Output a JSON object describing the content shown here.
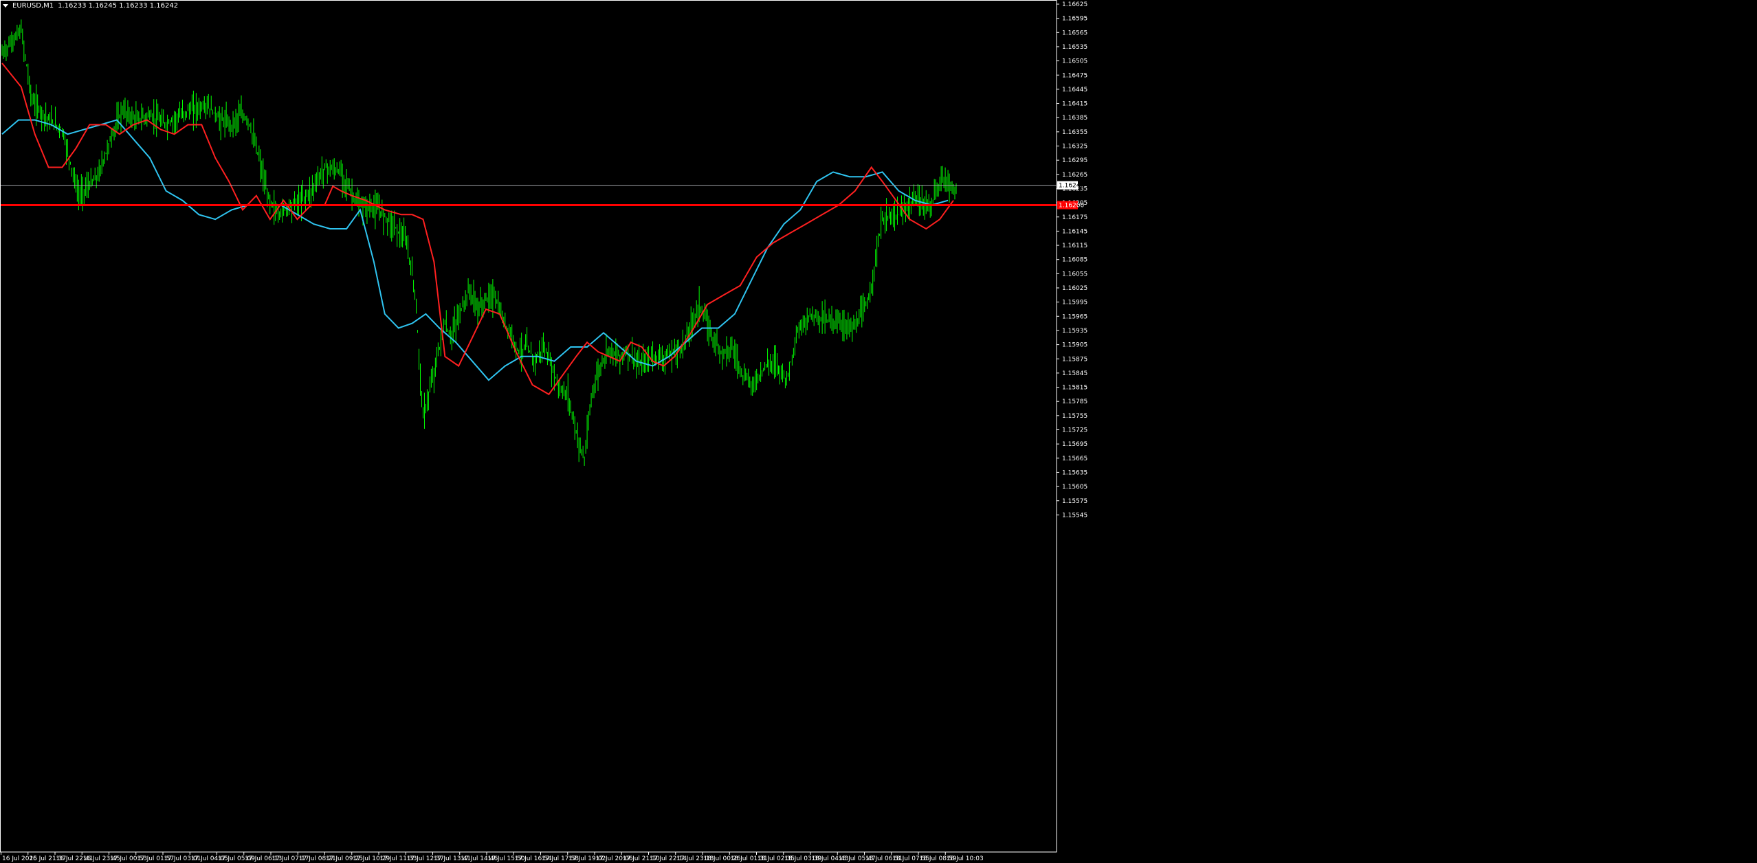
{
  "header": {
    "symbol_tf": "EURUSD,M1",
    "ohlc": "1.16233 1.16245 1.16233 1.16242"
  },
  "colors": {
    "background": "#000000",
    "candles": "#00ff00",
    "fast_ma": "#ff2020",
    "slow_ma": "#2fc4f0",
    "hline": "#ff0000",
    "bid_line": "#9fa3a8",
    "axis_text": "#ffffff"
  },
  "chart_data": {
    "type": "line",
    "title": "",
    "price_axis_ticks": [
      "1.16625",
      "1.16595",
      "1.16565",
      "1.16535",
      "1.16505",
      "1.16475",
      "1.16445",
      "1.16415",
      "1.16385",
      "1.16355",
      "1.16325",
      "1.16295",
      "1.16265",
      "1.16235",
      "1.16205",
      "1.16175",
      "1.16145",
      "1.16115",
      "1.16085",
      "1.16055",
      "1.16025",
      "1.15995",
      "1.15965",
      "1.15935",
      "1.15905",
      "1.15875",
      "1.15845",
      "1.15815",
      "1.15785",
      "1.15755",
      "1.15725",
      "1.15695",
      "1.15665",
      "1.15635",
      "1.15605",
      "1.15575",
      "1.15545"
    ],
    "time_axis_ticks": [
      "16 Jul 2025",
      "16 Jul 21:37",
      "16 Jul 22:41",
      "16 Jul 23:45",
      "17 Jul 00:53",
      "17 Jul 01:57",
      "17 Jul 03:01",
      "17 Jul 04:05",
      "17 Jul 05:09",
      "17 Jul 06:13",
      "17 Jul 07:17",
      "17 Jul 08:21",
      "17 Jul 09:25",
      "17 Jul 10:29",
      "17 Jul 11:33",
      "17 Jul 12:37",
      "17 Jul 13:41",
      "17 Jul 14:46",
      "17 Jul 15:50",
      "17 Jul 16:54",
      "17 Jul 17:58",
      "17 Jul 19:02",
      "17 Jul 20:06",
      "17 Jul 21:10",
      "17 Jul 22:14",
      "17 Jul 23:18",
      "18 Jul 00:26",
      "18 Jul 01:31",
      "18 Jul 02:35",
      "18 Jul 03:39",
      "18 Jul 04:43",
      "18 Jul 05:47",
      "18 Jul 06:51",
      "18 Jul 07:55",
      "18 Jul 08:59",
      "18 Jul 10:03"
    ],
    "ylim": [
      1.15535,
      1.16645
    ],
    "grid": false,
    "current_price_label": "1.16242",
    "hline_label": "1.16200",
    "hline_value": 1.162,
    "current_price": 1.16242,
    "series": [
      {
        "key": "price",
        "x": [
          0,
          7,
          11,
          17,
          22,
          28,
          35,
          41,
          44,
          49,
          54,
          60,
          68,
          75,
          80,
          84,
          87,
          90,
          94,
          97,
          101,
          105,
          109,
          113,
          118,
          124,
          130,
          138,
          143,
          148,
          151,
          154,
          157,
          160,
          162,
          164,
          166,
          168,
          171,
          174,
          177,
          180,
          183,
          186,
          189,
          192,
          195,
          198,
          201,
          204,
          207,
          210,
          213,
          216,
          219,
          222,
          225,
          229,
          233,
          238,
          243,
          249,
          255,
          260,
          263,
          267,
          271,
          275,
          279,
          283,
          287,
          291,
          296,
          301,
          307,
          312,
          317,
          322,
          328,
          334,
          340,
          344,
          349
        ],
        "values": [
          1.1652,
          1.1657,
          1.1642,
          1.1638,
          1.1636,
          1.1622,
          1.1626,
          1.1636,
          1.164,
          1.1638,
          1.1639,
          1.1637,
          1.164,
          1.1641,
          1.1638,
          1.1637,
          1.1639,
          1.1638,
          1.163,
          1.1622,
          1.1618,
          1.162,
          1.1621,
          1.1623,
          1.1628,
          1.1627,
          1.162,
          1.1619,
          1.1616,
          1.1612,
          1.1602,
          1.1575,
          1.1582,
          1.159,
          1.1595,
          1.1592,
          1.1595,
          1.1598,
          1.1602,
          1.1598,
          1.16,
          1.1601,
          1.1596,
          1.1593,
          1.1589,
          1.159,
          1.1587,
          1.159,
          1.1586,
          1.1581,
          1.158,
          1.1572,
          1.1566,
          1.1581,
          1.1586,
          1.159,
          1.1588,
          1.1589,
          1.1586,
          1.1588,
          1.1588,
          1.159,
          1.1599,
          1.1592,
          1.1589,
          1.159,
          1.1584,
          1.1582,
          1.1586,
          1.1587,
          1.1583,
          1.1593,
          1.1597,
          1.1596,
          1.1595,
          1.1594,
          1.16,
          1.1617,
          1.1618,
          1.1621,
          1.162,
          1.1626,
          1.1623
        ]
      },
      {
        "key": "fast_ma",
        "x": [
          0,
          7,
          12,
          17,
          22,
          27,
          32,
          38,
          43,
          48,
          53,
          58,
          63,
          68,
          73,
          78,
          83,
          88,
          93,
          98,
          103,
          108,
          113,
          118,
          121,
          124,
          128,
          133,
          140,
          146,
          150,
          154,
          158,
          162,
          167,
          172,
          177,
          182,
          188,
          194,
          200,
          205,
          210,
          214,
          218,
          222,
          226,
          230,
          234,
          238,
          242,
          246,
          252,
          258,
          264,
          270,
          276,
          282,
          288,
          294,
          300,
          306,
          312,
          318,
          322,
          327,
          332,
          338,
          343,
          348
        ],
        "values": [
          1.165,
          1.1645,
          1.1635,
          1.1628,
          1.1628,
          1.1632,
          1.1637,
          1.1637,
          1.1635,
          1.1637,
          1.1638,
          1.1636,
          1.1635,
          1.1637,
          1.1637,
          1.163,
          1.1625,
          1.1619,
          1.1622,
          1.1617,
          1.1621,
          1.1617,
          1.162,
          1.162,
          1.1624,
          1.1623,
          1.1622,
          1.1621,
          1.1619,
          1.1618,
          1.1618,
          1.1617,
          1.1608,
          1.1588,
          1.1586,
          1.1592,
          1.1598,
          1.1597,
          1.1589,
          1.1582,
          1.158,
          1.1584,
          1.1588,
          1.1591,
          1.1589,
          1.1588,
          1.1587,
          1.1591,
          1.159,
          1.1587,
          1.1586,
          1.1588,
          1.1593,
          1.1599,
          1.1601,
          1.1603,
          1.1609,
          1.1612,
          1.1614,
          1.1616,
          1.1618,
          1.162,
          1.1623,
          1.1628,
          1.1625,
          1.1621,
          1.1617,
          1.1615,
          1.1617,
          1.1621
        ]
      },
      {
        "key": "slow_ma",
        "x": [
          0,
          6,
          12,
          18,
          24,
          30,
          36,
          42,
          48,
          54,
          60,
          66,
          72,
          78,
          84,
          90,
          96,
          102,
          108,
          114,
          120,
          126,
          131,
          136,
          140,
          145,
          150,
          155,
          160,
          166,
          172,
          178,
          184,
          190,
          196,
          202,
          208,
          214,
          220,
          226,
          232,
          238,
          244,
          250,
          256,
          262,
          268,
          274,
          280,
          286,
          292,
          298,
          304,
          310,
          316,
          322,
          328,
          334,
          340,
          346
        ],
        "values": [
          1.1635,
          1.1638,
          1.1638,
          1.1637,
          1.1635,
          1.1636,
          1.1637,
          1.1638,
          1.1634,
          1.163,
          1.1623,
          1.1621,
          1.1618,
          1.1617,
          1.1619,
          1.162,
          1.162,
          1.162,
          1.1618,
          1.1616,
          1.1615,
          1.1615,
          1.1619,
          1.1608,
          1.1597,
          1.1594,
          1.1595,
          1.1597,
          1.1594,
          1.1591,
          1.1587,
          1.1583,
          1.1586,
          1.1588,
          1.1588,
          1.1587,
          1.159,
          1.159,
          1.1593,
          1.159,
          1.1587,
          1.1586,
          1.1588,
          1.1591,
          1.1594,
          1.1594,
          1.1597,
          1.1604,
          1.1611,
          1.1616,
          1.1619,
          1.1625,
          1.1627,
          1.1626,
          1.1626,
          1.1627,
          1.1623,
          1.1621,
          1.162,
          1.1621
        ]
      }
    ]
  }
}
